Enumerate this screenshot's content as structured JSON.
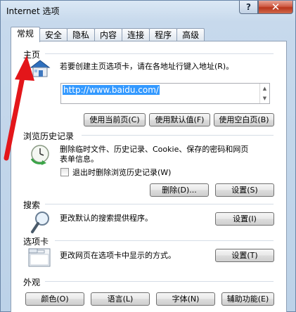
{
  "window": {
    "title": "Internet 选项",
    "help_label": "?",
    "close_label": "✕"
  },
  "tabs": [
    "常规",
    "安全",
    "隐私",
    "内容",
    "连接",
    "程序",
    "高级"
  ],
  "home": {
    "section_label": "主页",
    "description": "若要创建主页选项卡，请在各地址行键入地址(R)。",
    "url": "http://www.baidu.com/",
    "buttons": {
      "use_current": "使用当前页(C)",
      "use_default": "使用默认值(F)",
      "use_blank": "使用空白页(B)"
    }
  },
  "history": {
    "section_label": "浏览历史记录",
    "description_line1": "删除临时文件、历史记录、Cookie、保存的密码和网页",
    "description_line2": "表单信息。",
    "checkbox_label": "退出时删除浏览历史记录(W)",
    "checkbox_checked": false,
    "delete_button": "删除(D)...",
    "settings_button": "设置(S)"
  },
  "search": {
    "section_label": "搜索",
    "description": "更改默认的搜索提供程序。",
    "settings_button": "设置(I)"
  },
  "tabs_section": {
    "section_label": "选项卡",
    "description": "更改网页在选项卡中显示的方式。",
    "settings_button": "设置(T)"
  },
  "appearance": {
    "section_label": "外观",
    "buttons": {
      "colors": "颜色(O)",
      "languages": "语言(L)",
      "fonts": "字体(N)",
      "accessibility": "辅助功能(E)"
    }
  },
  "annotation": {
    "arrow_color": "#e3161a"
  }
}
